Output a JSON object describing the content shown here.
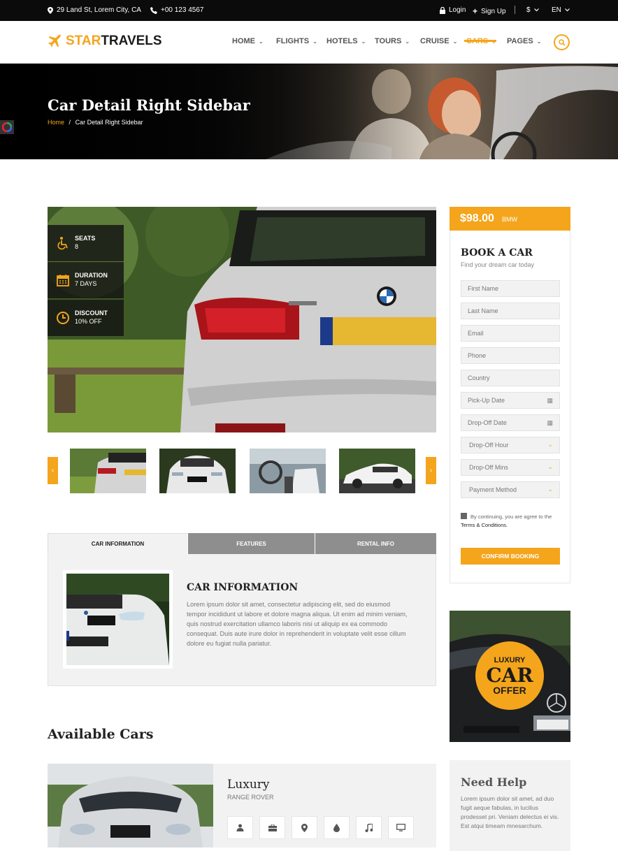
{
  "topbar": {
    "address": "29 Land St, Lorem City, CA",
    "phone": "+00 123 4567",
    "login": "Login",
    "signup": "Sign Up",
    "currency": "$",
    "language": "EN"
  },
  "brand": {
    "part1": "STAR",
    "part2": "TRAVELS"
  },
  "nav": {
    "items": [
      {
        "label": "HOME"
      },
      {
        "label": "FLIGHTS"
      },
      {
        "label": "HOTELS"
      },
      {
        "label": "TOURS"
      },
      {
        "label": "CRUISE"
      },
      {
        "label": "CARS",
        "active": true
      },
      {
        "label": "PAGES"
      }
    ]
  },
  "hero": {
    "title": "Car Detail Right Sidebar",
    "breadcrumb_home": "Home",
    "breadcrumb_sep": "/",
    "breadcrumb_current": "Car Detail Right Sidebar"
  },
  "features": [
    {
      "label": "SEATS",
      "value": "8",
      "icon": "accessibility-icon"
    },
    {
      "label": "DURATION",
      "value": "7 DAYS",
      "icon": "calendar-icon"
    },
    {
      "label": "DISCOUNT",
      "value": "10% OFF",
      "icon": "clock-icon"
    }
  ],
  "tabs": {
    "items": [
      {
        "label": "CAR INFORMATION",
        "active": true
      },
      {
        "label": "FEATURES"
      },
      {
        "label": "RENTAL INFO"
      }
    ],
    "panel_title": "CAR INFORMATION",
    "panel_text": "Lorem ipsum dolor sit amet, consectetur adipiscing elit, sed do eiusmod tempor incididunt ut labore et dolore magna aliqua. Ut enim ad minim veniam, quis nostrud exercitation ullamco laboris nisi ut aliquip ex ea commodo consequat. Duis aute irure dolor in reprehenderit in voluptate velit esse cillum dolore eu fugiat nulla pariatur."
  },
  "available": {
    "title": "Available Cars",
    "card": {
      "name": "Luxury",
      "subtitle": "RANGE ROVER"
    },
    "amenities": [
      "user-icon",
      "briefcase-icon",
      "map-pin-icon",
      "fuel-drop-icon",
      "music-icon",
      "monitor-icon"
    ]
  },
  "booking": {
    "price": "$98.00",
    "unit": "BMW",
    "title": "BOOK A CAR",
    "subtitle": "Find your dream car today",
    "fields": [
      {
        "placeholder": "First Name"
      },
      {
        "placeholder": "Last Name"
      },
      {
        "placeholder": "Email"
      },
      {
        "placeholder": "Phone"
      },
      {
        "placeholder": "Country"
      },
      {
        "placeholder": "Pick-Up Date"
      },
      {
        "placeholder": "Drop-Off Date"
      },
      {
        "placeholder": "Drop-Off Hour"
      },
      {
        "placeholder": "Drop-Off Mins"
      },
      {
        "placeholder": "Payment Method"
      }
    ],
    "terms_text": "By continuing, you are agree to the",
    "terms_link": "Terms & Conditions.",
    "confirm": "CONFIRM BOOKING"
  },
  "offer": {
    "line1": "LUXURY",
    "line2": "CAR",
    "line3": "OFFER"
  },
  "help": {
    "title": "Need Help",
    "text": "Lorem ipsum dolor sit amet, ad duo fugit aeque fabulas, in lucilius prodesset pri. Veniam delectus ei vis. Est atqui timeam mnesarchum."
  },
  "colors": {
    "accent": "#f4a51c",
    "topbar": "#0b0b0b",
    "panel": "#f2f2f2"
  }
}
